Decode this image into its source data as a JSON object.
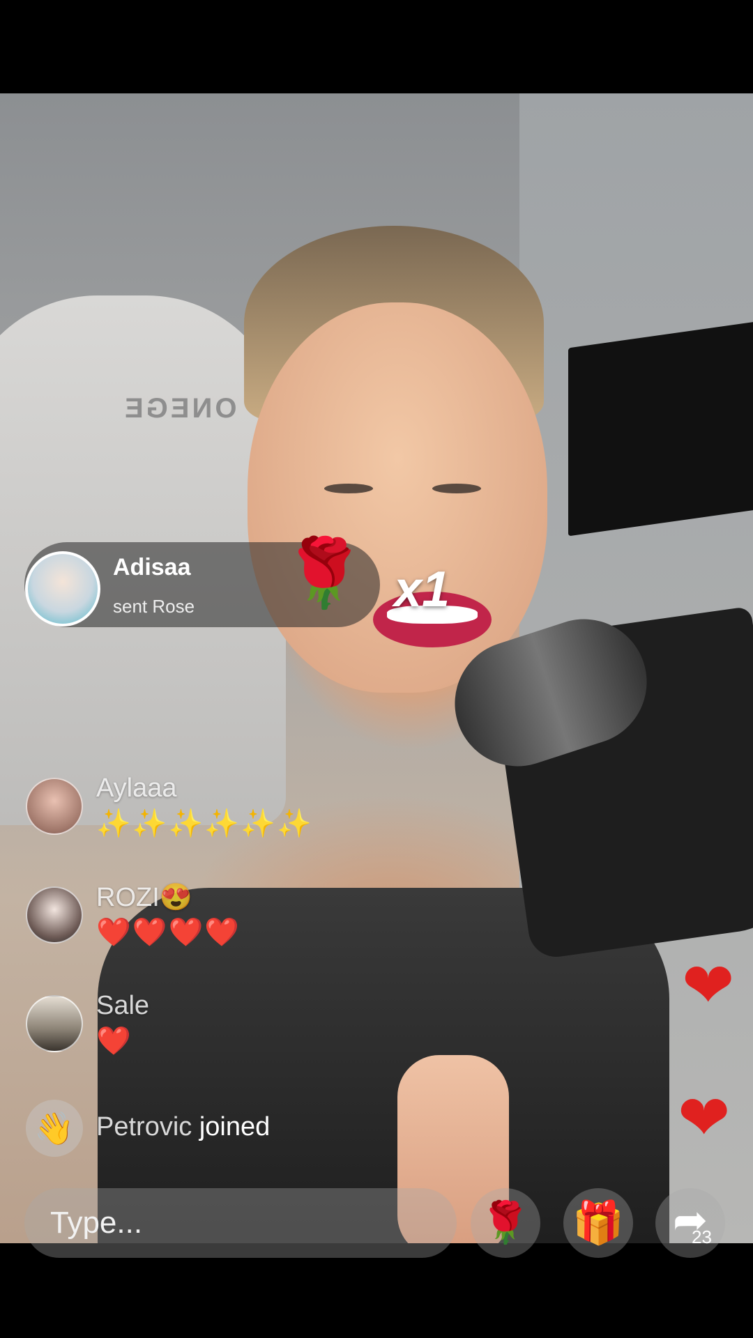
{
  "gift": {
    "sender": "Adisaa",
    "action": "sent Rose",
    "count": "x1",
    "gift_icon": "rose"
  },
  "comments": [
    {
      "user": "Aylaaa",
      "message": "✨✨✨✨✨✨"
    },
    {
      "user": "ROZI😍",
      "message": "❤️❤️❤️❤️"
    },
    {
      "user": "Sale",
      "message": "❤️"
    }
  ],
  "join": {
    "user": "Petrovic",
    "verb": "joined"
  },
  "composer": {
    "placeholder": "Type..."
  },
  "share": {
    "count": "23"
  },
  "colors": {
    "heart": "#e0211f",
    "gift_pink": "#ff2d7a"
  }
}
